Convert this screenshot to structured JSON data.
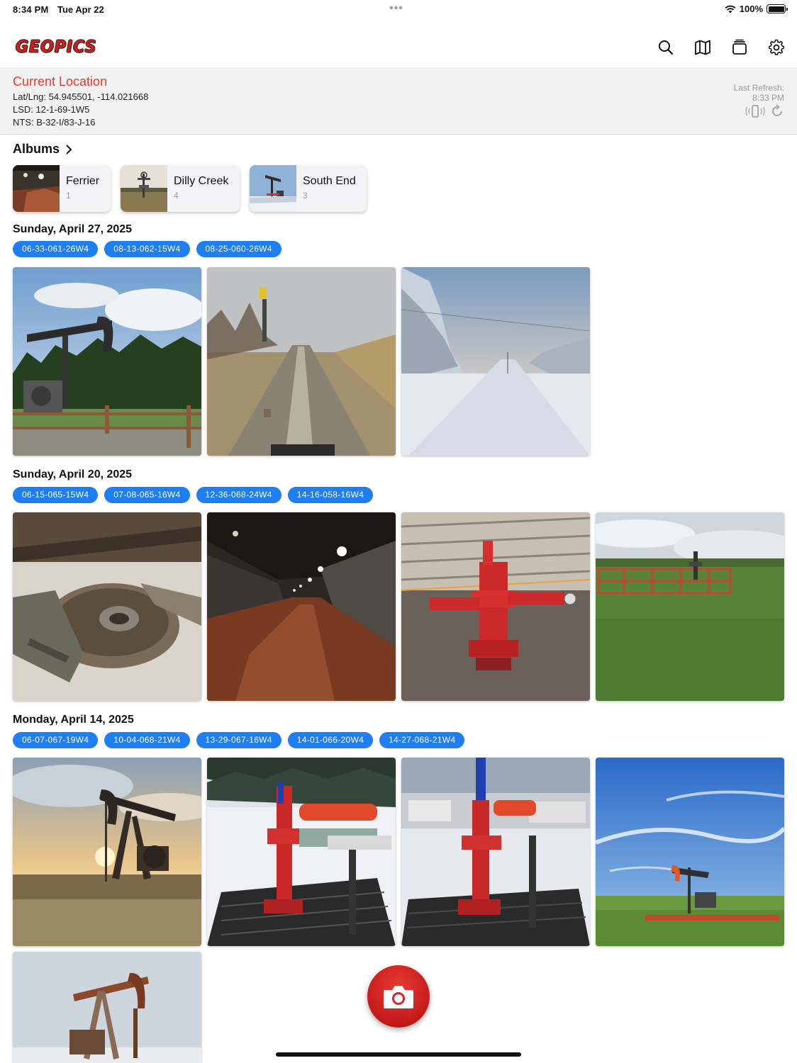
{
  "status_bar": {
    "time": "8:34 PM",
    "date": "Tue Apr 22",
    "battery": "100%"
  },
  "app": {
    "logo_text": "GEOPICS",
    "accent_color": "#e8392a",
    "chip_color": "#1e7ef2"
  },
  "toolbar": {
    "icons": [
      "search-icon",
      "map-icon",
      "stack-icon",
      "gear-icon"
    ]
  },
  "location": {
    "title": "Current Location",
    "latlng": "Lat/Lng: 54.945501, -114.021668",
    "lsd": "LSD: 12-1-69-1W5",
    "nts": "NTS: B-32-I/83-J-16",
    "refresh_label": "Last Refresh:",
    "refresh_time": "8:33 PM"
  },
  "albums": {
    "heading": "Albums",
    "items": [
      {
        "name": "Ferrier",
        "count": "1"
      },
      {
        "name": "Dilly Creek",
        "count": "4"
      },
      {
        "name": "South End",
        "count": "3"
      }
    ]
  },
  "sections": [
    {
      "date": "Sunday, April 27, 2025",
      "chips": [
        "06-33-061-26W4",
        "08-13-062-15W4",
        "08-25-060-26W4"
      ]
    },
    {
      "date": "Sunday, April 20, 2025",
      "chips": [
        "06-15-065-15W4",
        "07-08-065-16W4",
        "12-36-068-24W4",
        "14-16-058-16W4"
      ]
    },
    {
      "date": "Monday, April 14, 2025",
      "chips": [
        "06-07-067-19W4",
        "10-04-068-21W4",
        "13-29-067-16W4",
        "14-01-066-20W4",
        "14-27-068-21W4"
      ]
    }
  ]
}
